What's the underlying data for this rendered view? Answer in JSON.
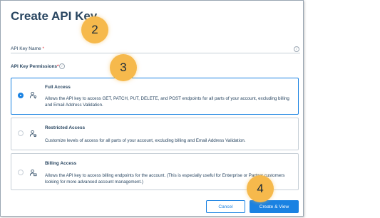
{
  "dialog": {
    "title": "Create API Key",
    "api_key_name_label": "API Key Name",
    "required_marker": "*",
    "permissions_label": "API Key Permissions",
    "permissions_required_marker": "*",
    "info_icon": "info-icon"
  },
  "permissions": [
    {
      "title": "Full Access",
      "description": "Allows the API key to access GET, PATCH, PUT, DELETE, and POST endpoints for all parts of your account, excluding billing and Email Address Validation.",
      "selected": true
    },
    {
      "title": "Restricted Access",
      "description": "Customize levels of access for all parts of your account, excluding billing and Email Address Validation.",
      "selected": false
    },
    {
      "title": "Billing Access",
      "description": "Allows the API key to access billing endpoints for the account. (This is especially useful for Enterprise or Partner customers looking for more advanced account management.)",
      "selected": false
    }
  ],
  "buttons": {
    "cancel": "Cancel",
    "create": "Create & View"
  },
  "step_badges": {
    "name_step": "2",
    "permissions_step": "3",
    "create_step": "4"
  },
  "colors": {
    "accent": "#1a82e2",
    "text": "#294661",
    "required": "#e4323e",
    "badge": "#f6b94c"
  }
}
